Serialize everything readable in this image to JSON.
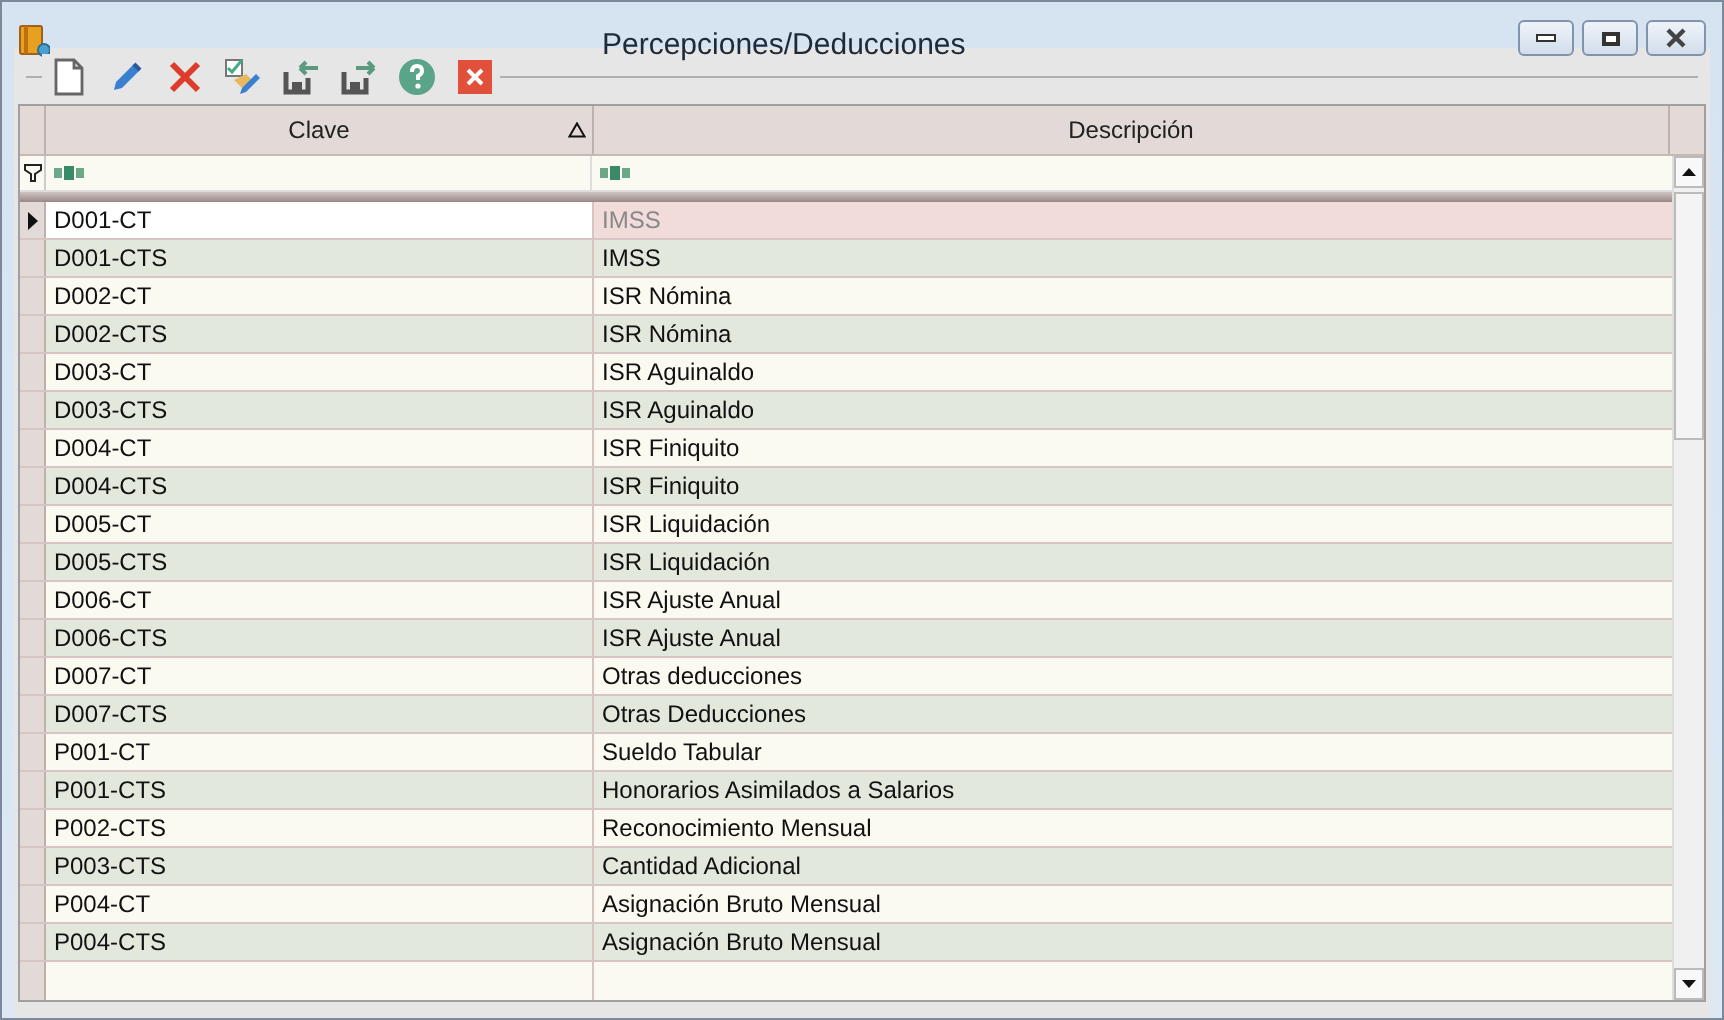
{
  "window": {
    "title": "Percepciones/Deducciones"
  },
  "toolbar": [
    {
      "kind": "new"
    },
    {
      "kind": "edit"
    },
    {
      "kind": "delete"
    },
    {
      "kind": "checkedit"
    },
    {
      "kind": "import"
    },
    {
      "kind": "export"
    },
    {
      "kind": "help"
    },
    {
      "kind": "close"
    }
  ],
  "table": {
    "columns": [
      {
        "label": "Clave",
        "sorted": true
      },
      {
        "label": "Descripción",
        "sorted": false
      }
    ],
    "rows": [
      {
        "clave": "D001-CT",
        "descripcion": "IMSS",
        "selected": true
      },
      {
        "clave": "D001-CTS",
        "descripcion": "IMSS",
        "selected": false
      },
      {
        "clave": "D002-CT",
        "descripcion": "ISR Nómina",
        "selected": false
      },
      {
        "clave": "D002-CTS",
        "descripcion": "ISR Nómina",
        "selected": false
      },
      {
        "clave": "D003-CT",
        "descripcion": "ISR Aguinaldo",
        "selected": false
      },
      {
        "clave": "D003-CTS",
        "descripcion": "ISR Aguinaldo",
        "selected": false
      },
      {
        "clave": "D004-CT",
        "descripcion": "ISR Finiquito",
        "selected": false
      },
      {
        "clave": "D004-CTS",
        "descripcion": "ISR Finiquito",
        "selected": false
      },
      {
        "clave": "D005-CT",
        "descripcion": "ISR Liquidación",
        "selected": false
      },
      {
        "clave": "D005-CTS",
        "descripcion": "ISR Liquidación",
        "selected": false
      },
      {
        "clave": "D006-CT",
        "descripcion": "ISR Ajuste Anual",
        "selected": false
      },
      {
        "clave": "D006-CTS",
        "descripcion": "ISR Ajuste Anual",
        "selected": false
      },
      {
        "clave": "D007-CT",
        "descripcion": "Otras deducciones",
        "selected": false
      },
      {
        "clave": "D007-CTS",
        "descripcion": "Otras Deducciones",
        "selected": false
      },
      {
        "clave": "P001-CT",
        "descripcion": "Sueldo Tabular",
        "selected": false
      },
      {
        "clave": "P001-CTS",
        "descripcion": "Honorarios Asimilados a Salarios",
        "selected": false
      },
      {
        "clave": "P002-CTS",
        "descripcion": "Reconocimiento Mensual",
        "selected": false
      },
      {
        "clave": "P003-CTS",
        "descripcion": "Cantidad Adicional",
        "selected": false
      },
      {
        "clave": "P004-CT",
        "descripcion": "Asignación Bruto Mensual",
        "selected": false
      },
      {
        "clave": "P004-CTS",
        "descripcion": "Asignación Bruto Mensual",
        "selected": false
      }
    ]
  }
}
